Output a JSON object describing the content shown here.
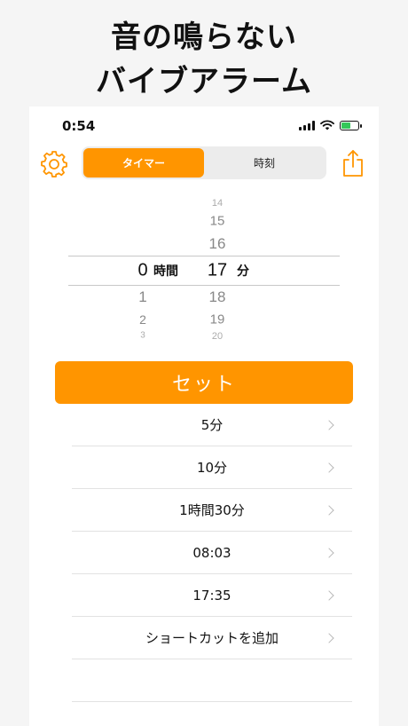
{
  "promo": {
    "line1": "音の鳴らない",
    "line2": "バイブアラーム"
  },
  "status_bar": {
    "time": "0:54",
    "battery_icon": "battery-charging-icon"
  },
  "toolbar": {
    "settings_icon": "gear-icon",
    "share_icon": "share-icon",
    "segments": [
      {
        "label": "タイマー",
        "active": true
      },
      {
        "label": "時刻",
        "active": false
      }
    ]
  },
  "picker": {
    "hours_unit": "時間",
    "minutes_unit": "分",
    "hours_selected": "0",
    "hours_below": [
      "1",
      "2",
      "3"
    ],
    "minutes_above": [
      "14",
      "15",
      "16"
    ],
    "minutes_selected": "17",
    "minutes_below": [
      "18",
      "19",
      "20"
    ]
  },
  "set_button": {
    "label": "セット"
  },
  "shortcuts": [
    {
      "label": "5分"
    },
    {
      "label": "10分"
    },
    {
      "label": "1時間30分"
    },
    {
      "label": "08:03"
    },
    {
      "label": "17:35"
    },
    {
      "label": "ショートカットを追加"
    }
  ],
  "colors": {
    "accent": "#ff9500",
    "battery_fill": "#34c759"
  }
}
